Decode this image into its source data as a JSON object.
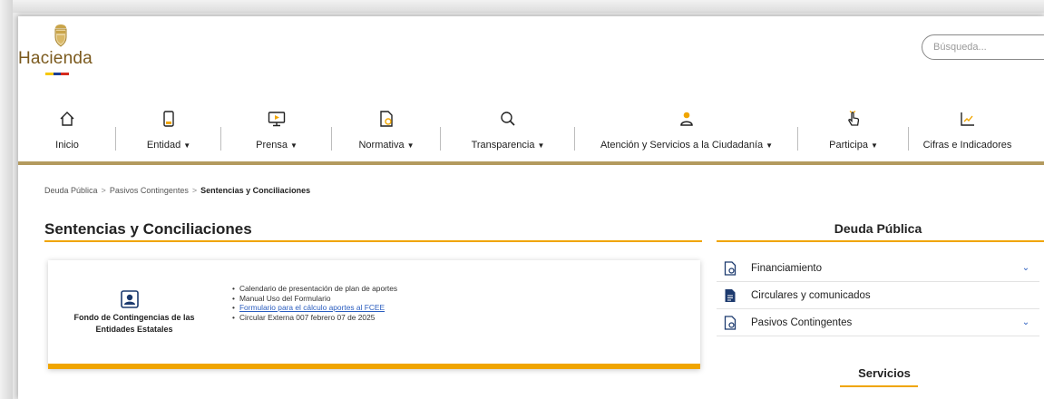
{
  "header": {
    "logo_text": "Hacienda",
    "search_placeholder": "Búsqueda..."
  },
  "nav": {
    "items": [
      {
        "label": "Inicio",
        "icon": "home-icon",
        "dropdown": false
      },
      {
        "label": "Entidad",
        "icon": "phone-icon",
        "dropdown": true
      },
      {
        "label": "Prensa",
        "icon": "play-screen-icon",
        "dropdown": true
      },
      {
        "label": "Normativa",
        "icon": "document-icon",
        "dropdown": true
      },
      {
        "label": "Transparencia",
        "icon": "search-icon",
        "dropdown": true
      },
      {
        "label": "Atención y Servicios a la Ciudadanía",
        "icon": "person-icon",
        "dropdown": true
      },
      {
        "label": "Participa",
        "icon": "hand-pointer-icon",
        "dropdown": true
      },
      {
        "label": "Cifras e Indicadores",
        "icon": "chart-icon",
        "dropdown": false
      }
    ],
    "caret": "▼"
  },
  "breadcrumb": {
    "items": [
      "Deuda Pública",
      "Pasivos Contingentes"
    ],
    "current": "Sentencias y Conciliaciones",
    "separator": ">"
  },
  "page": {
    "title": "Sentencias y Conciliaciones"
  },
  "card": {
    "name": "Fondo de Contingencias de las Entidades Estatales",
    "icon": "user-badge-icon",
    "items": [
      {
        "text": "Calendario de presentación de plan de aportes",
        "link": false
      },
      {
        "text": "Manual Uso del Formulario",
        "link": false
      },
      {
        "text": "Formulario para el cálculo aportes al FCEE",
        "link": true
      },
      {
        "text": "Circular Externa 007 febrero 07 de 2025",
        "link": false
      }
    ]
  },
  "sidebar": {
    "title": "Deuda Pública",
    "items": [
      {
        "label": "Financiamiento",
        "icon": "doc-gear-icon",
        "expandable": true
      },
      {
        "label": "Circulares y comunicados",
        "icon": "doc-filled-icon",
        "expandable": false
      },
      {
        "label": "Pasivos Contingentes",
        "icon": "doc-gear-icon",
        "expandable": true
      }
    ],
    "services_title": "Servicios"
  },
  "colors": {
    "accent": "#f0a500",
    "gold": "#b39a5e",
    "link": "#2a5dbf",
    "icon_navy": "#1c3a6e",
    "icon_orange": "#f0a500",
    "flag_yellow": "#f6c800",
    "flag_blue": "#1c3f94",
    "flag_red": "#d52b1e"
  }
}
